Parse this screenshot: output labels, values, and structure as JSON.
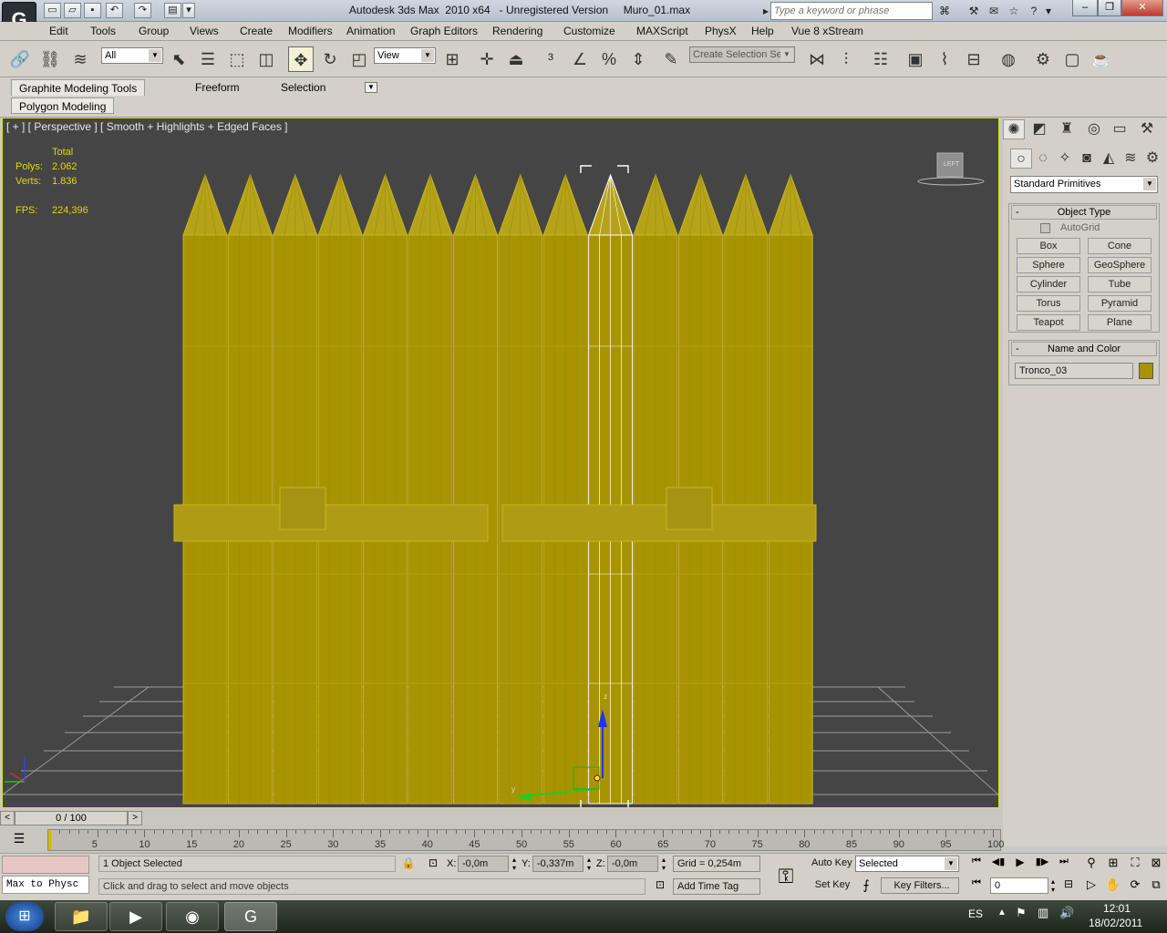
{
  "window": {
    "title": "Autodesk 3ds Max  2010 x64   - Unregistered Version     Muro_01.max",
    "search_placeholder": "Type a keyword or phrase"
  },
  "menu": [
    "Edit",
    "Tools",
    "Group",
    "Views",
    "Create",
    "Modifiers",
    "Animation",
    "Graph Editors",
    "Rendering",
    "Customize",
    "MAXScript",
    "PhysX",
    "Help",
    "Vue 8 xStream"
  ],
  "toolbar": {
    "selection_filter": "All",
    "reference_coord": "View",
    "named_selection_placeholder": "Create Selection Se"
  },
  "ribbon": {
    "tabs": [
      "Graphite Modeling Tools",
      "Freeform",
      "Selection"
    ],
    "subtab": "Polygon Modeling"
  },
  "viewport": {
    "label": "[ + ] [ Perspective ] [ Smooth + Highlights + Edged Faces ]",
    "stats": {
      "total_label": "Total",
      "polys_label": "Polys:",
      "polys_value": "2.062",
      "verts_label": "Verts:",
      "verts_value": "1.836",
      "fps_label": "FPS:",
      "fps_value": "224,396"
    },
    "viewcube_label": "LEFT",
    "gizmo_z": "z",
    "gizmo_y": "y"
  },
  "command_panel": {
    "category": "Standard Primitives",
    "object_type_title": "Object Type",
    "autogrid_label": "AutoGrid",
    "primitives": [
      "Box",
      "Cone",
      "Sphere",
      "GeoSphere",
      "Cylinder",
      "Tube",
      "Torus",
      "Pyramid",
      "Teapot",
      "Plane"
    ],
    "name_color_title": "Name and Color",
    "object_name": "Tronco_03",
    "object_color": "#a89400"
  },
  "timeline": {
    "frame_display": "0 / 100",
    "ticks": [
      "5",
      "10",
      "15",
      "20",
      "25",
      "30",
      "35",
      "40",
      "45",
      "50",
      "55",
      "60",
      "65",
      "70",
      "75",
      "80",
      "85",
      "90",
      "95",
      "100"
    ]
  },
  "status": {
    "selection": "1 Object Selected",
    "prompt": "Click and drag to select and move objects",
    "script_listener": "Max to Physc",
    "x_label": "X:",
    "x_value": "-0,0m",
    "y_label": "Y:",
    "y_value": "-0,337m",
    "z_label": "Z:",
    "z_value": "-0,0m",
    "grid": "Grid = 0,254m",
    "add_time_tag": "Add Time Tag",
    "auto_key": "Auto Key",
    "key_mode": "Selected",
    "set_key": "Set Key",
    "key_filters": "Key Filters...",
    "current_frame": "0"
  },
  "taskbar": {
    "language": "ES",
    "time": "12:01",
    "date": "18/02/2011"
  },
  "colors": {
    "viewport_bg": "#454545",
    "log_yellow": "#a89400",
    "stat_text": "#e4d800"
  }
}
